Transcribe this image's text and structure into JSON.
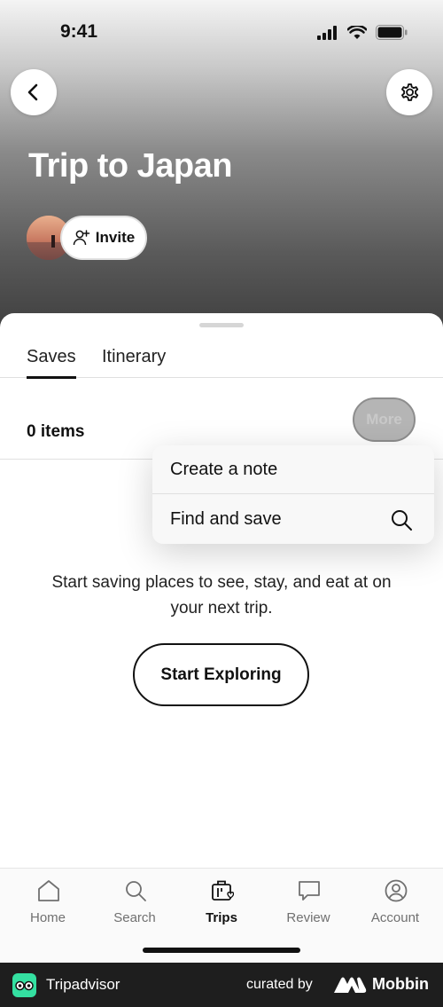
{
  "status_bar": {
    "time": "9:41"
  },
  "header": {
    "title": "Trip to Japan",
    "invite_label": "Invite"
  },
  "tabs": [
    {
      "label": "Saves",
      "active": true
    },
    {
      "label": "Itinerary",
      "active": false
    }
  ],
  "saves": {
    "count_label": "0 items",
    "more_label": "More"
  },
  "popup_menu": {
    "items": [
      {
        "label": "Create a note"
      },
      {
        "label": "Find and save",
        "icon": "search-icon"
      }
    ]
  },
  "empty_state": {
    "message": "Start saving places to see, stay, and eat at on your next trip.",
    "button_label": "Start Exploring"
  },
  "bottom_nav": {
    "items": [
      {
        "label": "Home",
        "icon": "home-icon",
        "active": false
      },
      {
        "label": "Search",
        "icon": "search-icon",
        "active": false
      },
      {
        "label": "Trips",
        "icon": "suitcase-heart-icon",
        "active": true
      },
      {
        "label": "Review",
        "icon": "speech-bubble-icon",
        "active": false
      },
      {
        "label": "Account",
        "icon": "account-icon",
        "active": false
      }
    ]
  },
  "footer": {
    "brand": "Tripadvisor",
    "curated_by": "curated by",
    "curator": "Mobbin"
  },
  "colors": {
    "tripadvisor_green": "#34e0a1",
    "footer_bg": "#1e1e1e"
  }
}
